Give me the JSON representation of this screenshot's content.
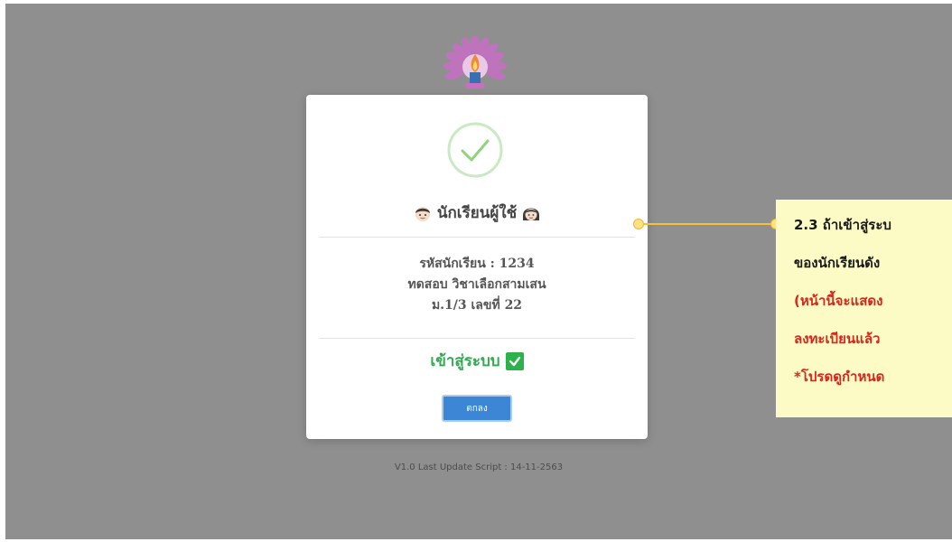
{
  "footer": {
    "version_text": "V1.0 Last Update Script : 14-11-2563"
  },
  "modal": {
    "title": "นักเรียนผู้ใช้",
    "student_id": "รหัสนักเรียน : 1234",
    "student_name": "ทดสอบ วิชาเลือกสามเสน",
    "student_class": "ม.1/3 เลขที่ 22",
    "login_status": "เข้าสู่ระบบ",
    "ok_button": "ตกลง"
  },
  "callout": {
    "line1": "2.3 ถ้าเข้าสู่ระบ",
    "line2": "ของนักเรียนดัง",
    "line3": "(หน้านี้จะแสดง",
    "line4": "ลงทะเบียนแล้ว",
    "line5": "*โปรดดูกำหนด"
  },
  "colors": {
    "overlay": "#8f8f8f",
    "success_green": "#33a852",
    "button_blue": "#3d86d6",
    "callout_bg": "#fdfbc5",
    "callout_red": "#d9261c",
    "connector_yellow": "#f4c23a"
  },
  "icons": [
    "logo-emblem-icon",
    "success-check-icon",
    "boy-face-icon",
    "girl-face-icon",
    "checkmark-box-icon"
  ]
}
